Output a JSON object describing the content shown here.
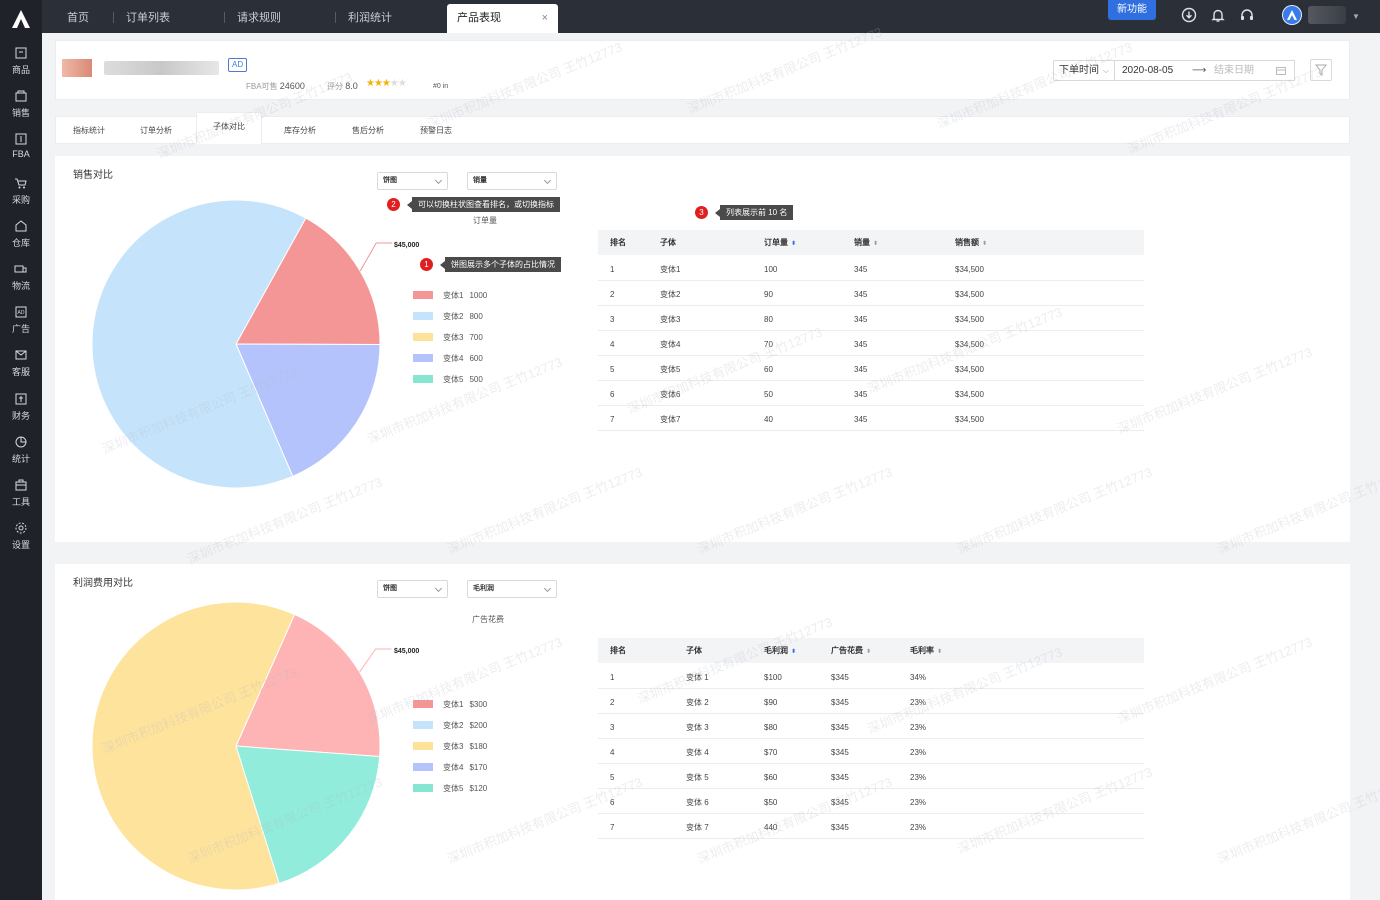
{
  "sidebar": {
    "items": [
      {
        "label": "商品",
        "icon": "product-icon"
      },
      {
        "label": "销售",
        "icon": "sales-icon"
      },
      {
        "label": "FBA",
        "icon": "fba-icon"
      },
      {
        "label": "采购",
        "icon": "cart-icon"
      },
      {
        "label": "仓库",
        "icon": "warehouse-icon"
      },
      {
        "label": "物流",
        "icon": "truck-icon"
      },
      {
        "label": "广告",
        "icon": "ad-icon"
      },
      {
        "label": "客服",
        "icon": "mail-icon"
      },
      {
        "label": "财务",
        "icon": "finance-icon"
      },
      {
        "label": "统计",
        "icon": "chart-icon"
      },
      {
        "label": "工具",
        "icon": "toolbox-icon"
      },
      {
        "label": "设置",
        "icon": "gear-icon"
      }
    ]
  },
  "topbar": {
    "tabs": [
      "首页",
      "订单列表",
      "请求规则",
      "利润统计"
    ],
    "active_tab": "产品表现",
    "close": "×",
    "new_feature": "新功能"
  },
  "product": {
    "ad_badge": "AD",
    "fba_label": "FBA可售",
    "fba_value": "24600",
    "rating_label": "评分",
    "rating_value": "8.0",
    "stars_on": "★★★",
    "stars_off": "★★",
    "extra": "#0 in"
  },
  "filter": {
    "field": "下单时间",
    "start_date": "2020-08-05",
    "arrow": "⟶",
    "end_placeholder": "结束日期"
  },
  "subtabs": [
    "指标统计",
    "订单分析",
    "子体对比",
    "库存分析",
    "售后分析",
    "预警日志"
  ],
  "sales": {
    "title": "销售对比",
    "select_type": "饼图",
    "select_metric": "销量",
    "subhead": "订单量",
    "callout_1": "饼图展示多个子体的占比情况",
    "callout_2": "可以切换柱状图查看排名，或切换指标",
    "callout_3": "列表展示前 10 名",
    "marker_1": "1",
    "marker_2": "2",
    "marker_3": "3",
    "table": {
      "headers": [
        "排名",
        "子体",
        "订单量",
        "销量",
        "销售额"
      ],
      "rows": [
        [
          "1",
          "变体1",
          "100",
          "345",
          "$34,500"
        ],
        [
          "2",
          "变体2",
          "90",
          "345",
          "$34,500"
        ],
        [
          "3",
          "变体3",
          "80",
          "345",
          "$34,500"
        ],
        [
          "4",
          "变体4",
          "70",
          "345",
          "$34,500"
        ],
        [
          "5",
          "变体5",
          "60",
          "345",
          "$34,500"
        ],
        [
          "6",
          "变体6",
          "50",
          "345",
          "$34,500"
        ],
        [
          "7",
          "变体7",
          "40",
          "345",
          "$34,500"
        ]
      ]
    }
  },
  "profit": {
    "title": "利润费用对比",
    "select_type": "饼图",
    "select_metric": "毛利润",
    "subhead": "广告花费",
    "table": {
      "headers": [
        "排名",
        "子体",
        "毛利润",
        "广告花费",
        "毛利率"
      ],
      "rows": [
        [
          "1",
          "变体 1",
          "$100",
          "$345",
          "34%"
        ],
        [
          "2",
          "变体 2",
          "$90",
          "$345",
          "23%"
        ],
        [
          "3",
          "变体 3",
          "$80",
          "$345",
          "23%"
        ],
        [
          "4",
          "变体 4",
          "$70",
          "$345",
          "23%"
        ],
        [
          "5",
          "变体 5",
          "$60",
          "$345",
          "23%"
        ],
        [
          "6",
          "变体 6",
          "$50",
          "$345",
          "23%"
        ],
        [
          "7",
          "变体 7",
          "440",
          "$345",
          "23%"
        ]
      ]
    }
  },
  "chart_data": [
    {
      "type": "pie",
      "callout_label": "$45,000",
      "categories": [
        "变体1",
        "变体2",
        "变体3",
        "变体4",
        "变体5"
      ],
      "legend_values": [
        "1000",
        "800",
        "700",
        "600",
        "500"
      ],
      "slice_colors": [
        "#f49596",
        "#c5e4fb",
        "#fde39a",
        "#b4c3fb",
        "#86e6d2"
      ],
      "drawn_slices": [
        {
          "name": "变体1",
          "share": 0.17,
          "color": "#f49596"
        },
        {
          "name": "变体4",
          "share": 0.185,
          "color": "#b4c3fb"
        },
        {
          "name": "变体2",
          "share": 0.645,
          "color": "#c5e4fb"
        }
      ]
    },
    {
      "type": "pie",
      "callout_label": "$45,000",
      "categories": [
        "变体1",
        "变体2",
        "变体3",
        "变体4",
        "变体5"
      ],
      "legend_values": [
        "$300",
        "$200",
        "$180",
        "$170",
        "$120"
      ],
      "slice_colors": [
        "#f49596",
        "#c5e4fb",
        "#fde39a",
        "#b4c3fb",
        "#86e6d2"
      ],
      "drawn_slices": [
        {
          "name": "变体1",
          "share": 0.195,
          "color": "#feb3b4"
        },
        {
          "name": "变体5",
          "share": 0.19,
          "color": "#91ecdb"
        },
        {
          "name": "变体3",
          "share": 0.615,
          "color": "#fee39d"
        }
      ]
    }
  ],
  "watermark": "深圳市积加科技有限公司 王竹12773"
}
